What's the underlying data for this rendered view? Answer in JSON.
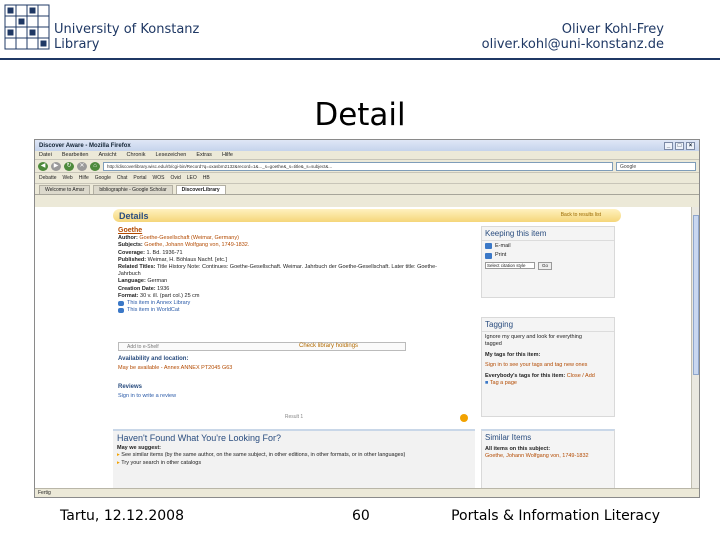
{
  "slide": {
    "institution_line1": "University of Konstanz",
    "institution_line2": "Library",
    "author_name": "Oliver Kohl-Frey",
    "author_email": "oliver.kohl@uni-konstanz.de",
    "title": "Detail",
    "footer_left": "Tartu, 12.12.2008",
    "footer_center": "60",
    "footer_right": "Portals & Information Literacy",
    "accent_color": "#1f3864"
  },
  "browser": {
    "window_title": "Discover Aware - Mozilla Firefox",
    "window_buttons": [
      "_",
      "□",
      "×"
    ],
    "menu": [
      "Datei",
      "Bearbeiten",
      "Ansicht",
      "Chronik",
      "Lesezeichen",
      "Extras",
      "Hilfe"
    ],
    "url": "http://discoverlibrary.wisc.edu/rb/cgi-bin/Record?q=oxasbm2132&record=1&..._s=goethe&_s=title&_s=subject&...",
    "search_box": "Google",
    "bookmarks": [
      "Debatte",
      "Web",
      "Hilfe",
      "Google",
      "Chat",
      "Portal",
      "WOS",
      "Ovid",
      "LEO",
      "HB"
    ],
    "tabs": [
      {
        "label": "Welcome to Amar",
        "active": false
      },
      {
        "label": "bibliographie - Google Scholar",
        "active": false
      },
      {
        "label": "DiscoverLibrary",
        "active": true
      }
    ],
    "status": "Fertig"
  },
  "page": {
    "details_heading": "Details",
    "details_right": "Back to results list",
    "record_title": "Goethe",
    "fields": [
      {
        "label": "Author:",
        "value": "Goethe-Gesellschaft (Weimar, Germany)"
      },
      {
        "label": "Subjects:",
        "value": "Goethe, Johann Wolfgang von, 1749-1832."
      },
      {
        "label": "Coverage:",
        "value": "1. Bd. 1936-71"
      },
      {
        "label": "Published:",
        "value": "Weimar, H. Böhlaus Nachf. [etc.]"
      },
      {
        "label": "Related Titles:",
        "value": "Title History Note: Continues: Goethe-Gesellschaft. Weimar. Jahrbuch der Goethe-Gesellschaft. Later title: Goethe-Jahrbuch"
      },
      {
        "label": "Language:",
        "value": "German"
      },
      {
        "label": "Creation Date:",
        "value": "1936"
      },
      {
        "label": "Format:",
        "value": "30 v. ill. (part col.) 25 cm"
      }
    ],
    "item_links": [
      "This item in Annex Library",
      "This item in WorldCat"
    ],
    "save_placeholder": "Add to e-Shelf",
    "check_holdings": "Check library holdings",
    "availability_heading": "Availability and location:",
    "availability_text": "May be available - Annex ANNEX PT2045 G63",
    "reviews_heading": "Reviews",
    "reviews_text": "Sign in to write a review",
    "result_nav": "Result 1",
    "keeping": {
      "heading": "Keeping this item",
      "actions": [
        "E-mail",
        "Print"
      ],
      "select_value": "Select citation style",
      "go_label": "Go"
    },
    "tagging": {
      "heading": "Tagging",
      "lines": [
        "Ignore my query and look for everything",
        "tagged"
      ],
      "my_tags_label": "My tags for this item:",
      "sign_in": "Sign in to see your tags and tag new ones",
      "everybody_label": "Everybody's tags for this item:",
      "everybody_links": "Close / Add",
      "tag_link": "Tag a page"
    },
    "havent_found": {
      "heading": "Haven't Found What You're Looking For?",
      "suggest": "May we suggest:",
      "items": [
        "See similar items (by the same author, on the same subject, in other editions, in other formats, or in other languages)",
        "Try your search in other catalogs"
      ]
    },
    "similar": {
      "heading": "Similar Items",
      "subtitle": "All items on this subject:",
      "item": "Goethe, Johann Wolfgang von, 1749-1832"
    }
  }
}
